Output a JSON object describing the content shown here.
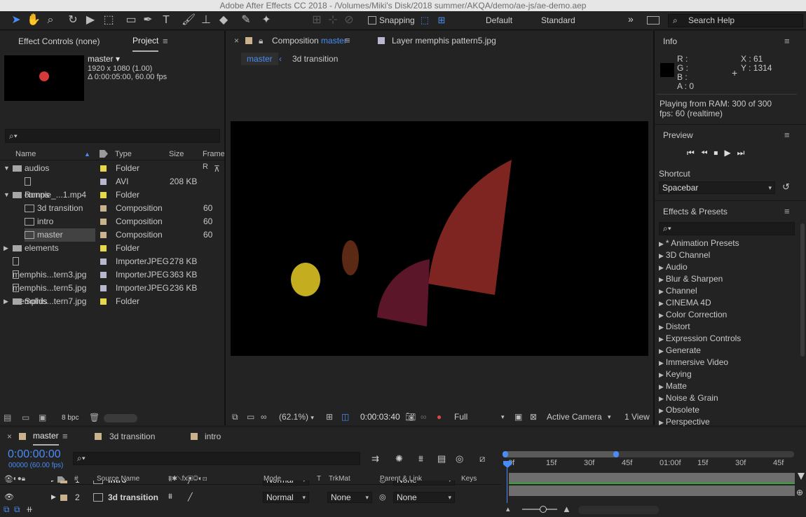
{
  "window": {
    "title": "Adobe After Effects CC 2018 - /Volumes/Miki's Disk/2018 summer/AKQA/demo/ae-js/ae-demo.aep"
  },
  "toolbar": {
    "snapping_label": "Snapping",
    "workspace_default": "Default",
    "workspace_standard": "Standard",
    "search_placeholder": "Search Help"
  },
  "left_panel": {
    "tab_effect_controls": "Effect Controls (none)",
    "tab_project": "Project",
    "thumb_name": "master",
    "thumb_dims": "1920 x 1080 (1.00)",
    "thumb_duration": "Δ 0:00:05:00, 60.00 fps",
    "columns": {
      "name": "Name",
      "type": "Type",
      "size": "Size",
      "frame": "Frame R"
    },
    "rows": [
      {
        "name": "audios",
        "type": "Folder",
        "size": "",
        "frame": "",
        "color": "#e6d84a",
        "kind": "folder",
        "indent": 0,
        "expand": "▼"
      },
      {
        "name": "Ronnie_...1.mp4",
        "type": "AVI",
        "size": "208 KB",
        "frame": "",
        "color": "#b7b7cf",
        "kind": "file",
        "indent": 1,
        "expand": ""
      },
      {
        "name": "comps",
        "type": "Folder",
        "size": "",
        "frame": "",
        "color": "#e6d84a",
        "kind": "folder",
        "indent": 0,
        "expand": "▼"
      },
      {
        "name": "3d transition",
        "type": "Composition",
        "size": "",
        "frame": "60",
        "color": "#c9b28c",
        "kind": "comp",
        "indent": 1,
        "expand": ""
      },
      {
        "name": "intro",
        "type": "Composition",
        "size": "",
        "frame": "60",
        "color": "#c9b28c",
        "kind": "comp",
        "indent": 1,
        "expand": ""
      },
      {
        "name": "master",
        "type": "Composition",
        "size": "",
        "frame": "60",
        "color": "#c9b28c",
        "kind": "comp",
        "indent": 1,
        "expand": "",
        "selected": true
      },
      {
        "name": "elements",
        "type": "Folder",
        "size": "",
        "frame": "",
        "color": "#e6d84a",
        "kind": "folder",
        "indent": 0,
        "expand": "▶"
      },
      {
        "name": "memphis...tern3.jpg",
        "type": "ImporterJPEG",
        "size": "278 KB",
        "frame": "",
        "color": "#b7b7cf",
        "kind": "file",
        "indent": 0,
        "expand": ""
      },
      {
        "name": "memphis...tern5.jpg",
        "type": "ImporterJPEG",
        "size": "363 KB",
        "frame": "",
        "color": "#b7b7cf",
        "kind": "file",
        "indent": 0,
        "expand": ""
      },
      {
        "name": "memphis...tern7.jpg",
        "type": "ImporterJPEG",
        "size": "236 KB",
        "frame": "",
        "color": "#b7b7cf",
        "kind": "file",
        "indent": 0,
        "expand": ""
      },
      {
        "name": "Solids",
        "type": "Folder",
        "size": "",
        "frame": "",
        "color": "#e6d84a",
        "kind": "folder",
        "indent": 0,
        "expand": "▶"
      }
    ],
    "bpc": "8 bpc"
  },
  "viewer": {
    "tab_composition_prefix": "Composition",
    "tab_composition_name": "master",
    "tab_layer": "Layer memphis pattern5.jpg",
    "breadcrumb_current": "master",
    "breadcrumb_next": "3d transition",
    "zoom": "(62.1%)",
    "timecode": "0:00:03:40",
    "resolution": "Full",
    "camera": "Active Camera",
    "views": "1 View"
  },
  "info": {
    "title": "Info",
    "r_label": "R :",
    "g_label": "G :",
    "b_label": "B :",
    "a_label": "A :",
    "a_value": "0",
    "x_label": "X : 61",
    "y_label": "Y : 1314",
    "ram": "Playing from RAM: 300 of 300",
    "fps": "fps: 60 (realtime)"
  },
  "preview": {
    "title": "Preview",
    "shortcut_label": "Shortcut",
    "shortcut_value": "Spacebar"
  },
  "effects": {
    "title": "Effects & Presets",
    "items": [
      "* Animation Presets",
      "3D Channel",
      "Audio",
      "Blur & Sharpen",
      "Channel",
      "CINEMA 4D",
      "Color Correction",
      "Distort",
      "Expression Controls",
      "Generate",
      "Immersive Video",
      "Keying",
      "Matte",
      "Noise & Grain",
      "Obsolete",
      "Perspective"
    ]
  },
  "timeline": {
    "tab_master": "master",
    "tab_3d": "3d transition",
    "tab_intro": "intro",
    "timecode": "0:00:00:00",
    "frames": "00000 (60.00 fps)",
    "col_num": "#",
    "col_source": "Source Name",
    "col_mode": "Mode",
    "col_t": "T",
    "col_trkmat": "TrkMat",
    "col_parent": "Parent & Link",
    "col_keys": "Keys",
    "ruler": [
      "0f",
      "15f",
      "30f",
      "45f",
      "01:00f",
      "15f",
      "30f",
      "45f"
    ],
    "layers": [
      {
        "num": "1",
        "name": "intro",
        "mode": "Normal",
        "trkmat": "",
        "parent": "None"
      },
      {
        "num": "2",
        "name": "3d transition",
        "mode": "Normal",
        "trkmat": "None",
        "parent": "None"
      }
    ]
  }
}
